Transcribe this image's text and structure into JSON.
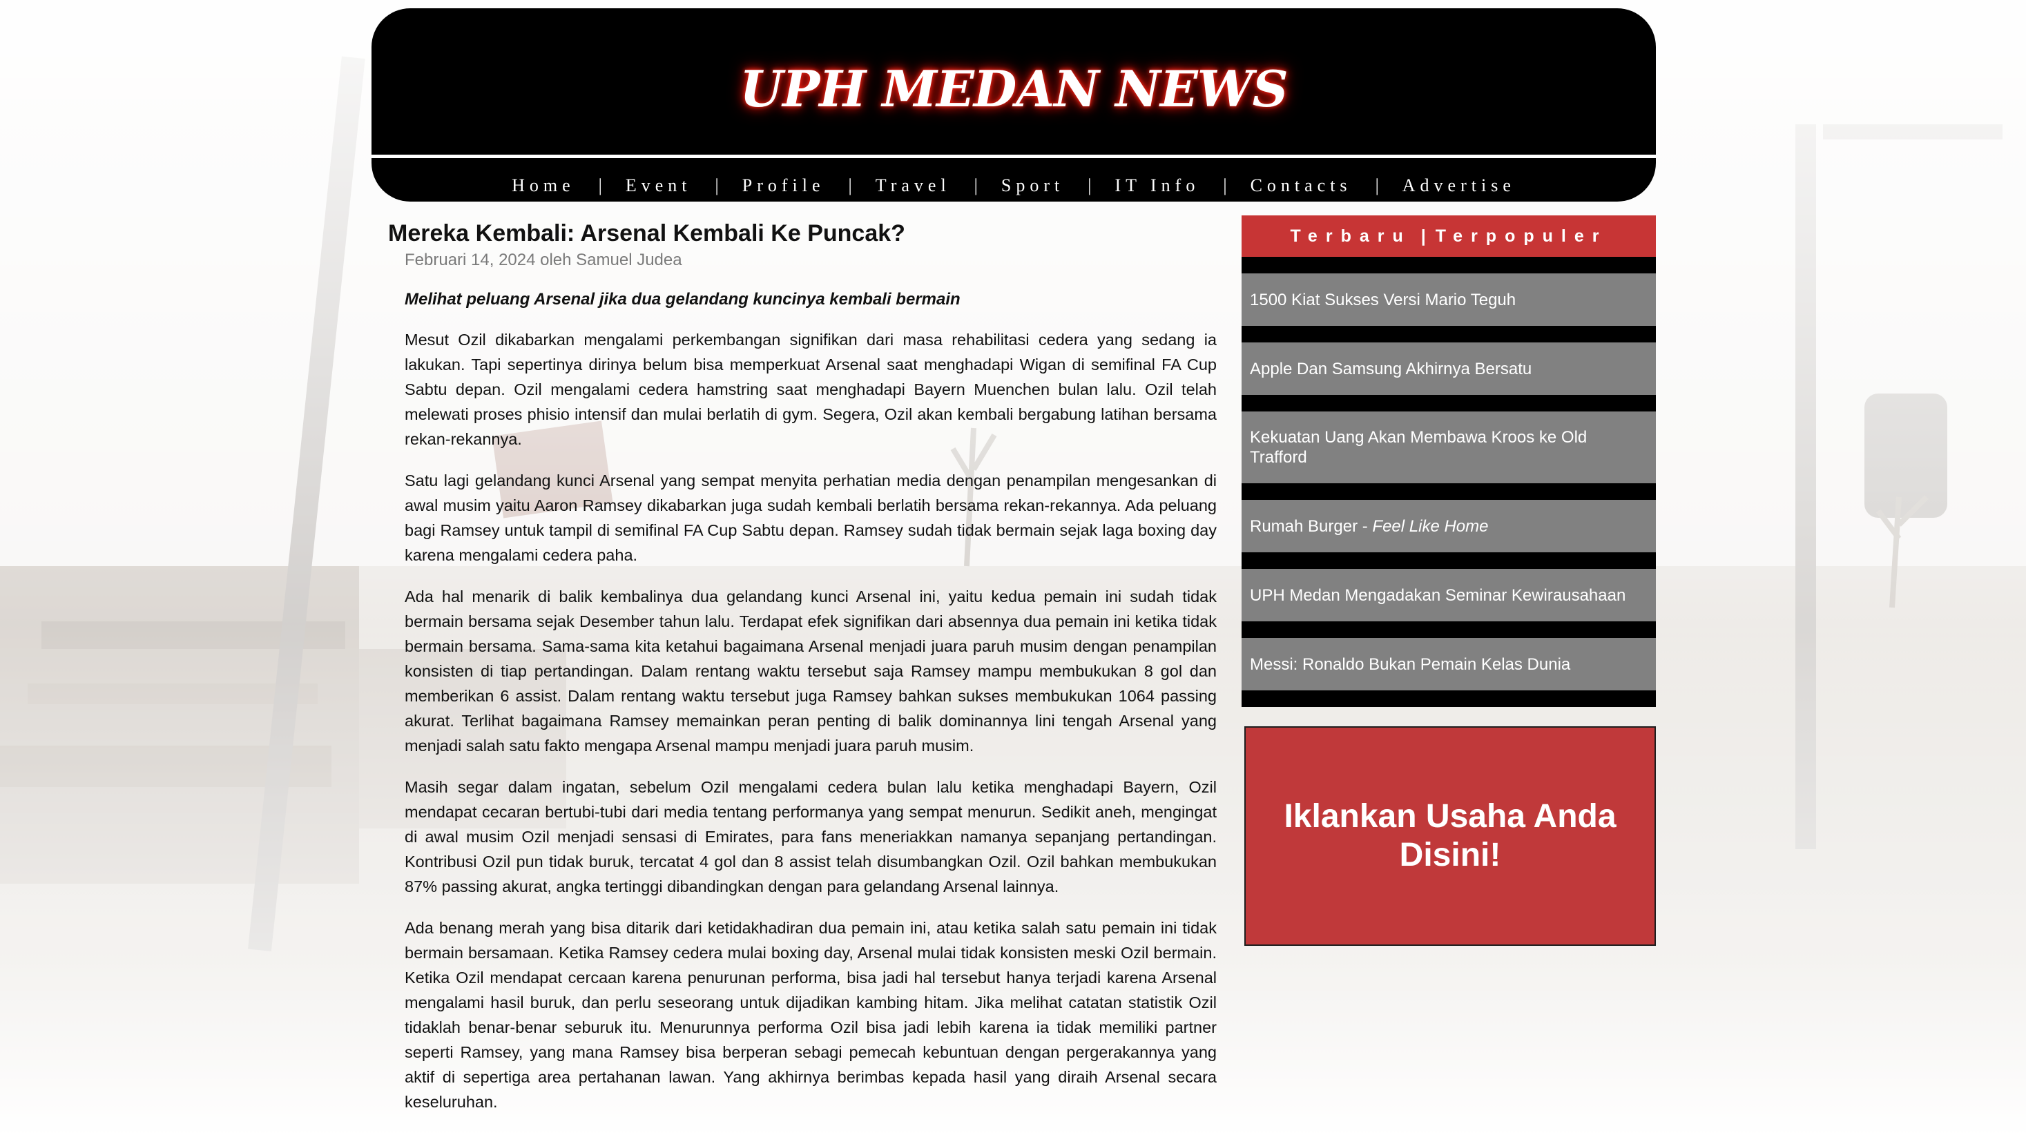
{
  "site": {
    "title": "UPH MEDAN NEWS"
  },
  "nav": {
    "items": [
      "Home",
      "Event",
      "Profile",
      "Travel",
      "Sport",
      "IT Info",
      "Contacts",
      "Advertise"
    ],
    "separator": "|"
  },
  "article": {
    "title": "Mereka Kembali: Arsenal Kembali Ke Puncak?",
    "meta": "Februari 14, 2024 oleh Samuel Judea",
    "lead": "Melihat peluang Arsenal jika dua gelandang kuncinya kembali bermain",
    "paragraphs": [
      "Mesut Ozil dikabarkan mengalami perkembangan signifikan dari masa rehabilitasi cedera yang sedang ia lakukan. Tapi sepertinya dirinya belum bisa memperkuat Arsenal saat menghadapi Wigan di semifinal FA Cup Sabtu depan. Ozil mengalami cedera hamstring saat menghadapi Bayern Muenchen bulan lalu. Ozil telah melewati proses phisio intensif dan mulai berlatih di gym. Segera, Ozil akan kembali bergabung latihan bersama rekan-rekannya.",
      "Satu lagi gelandang kunci Arsenal yang sempat menyita perhatian media dengan penampilan mengesankan di awal musim yaitu Aaron Ramsey dikabarkan juga sudah kembali berlatih bersama rekan-rekannya. Ada peluang bagi Ramsey untuk tampil di semifinal FA Cup Sabtu depan. Ramsey sudah tidak bermain sejak laga boxing day karena mengalami cedera paha.",
      "Ada hal menarik di balik kembalinya dua gelandang kunci Arsenal ini, yaitu kedua pemain ini sudah tidak bermain bersama sejak Desember tahun lalu. Terdapat efek signifikan dari absennya dua pemain ini ketika tidak bermain bersama. Sama-sama kita ketahui bagaimana Arsenal menjadi juara paruh musim dengan penampilan konsisten di tiap pertandingan. Dalam rentang waktu tersebut saja Ramsey mampu membukukan 8 gol dan memberikan 6 assist. Dalam rentang waktu tersebut juga Ramsey bahkan sukses membukukan 1064 passing akurat. Terlihat bagaimana Ramsey memainkan peran penting di balik dominannya lini tengah Arsenal yang menjadi salah satu fakto mengapa Arsenal mampu menjadi juara paruh musim.",
      "Masih segar dalam ingatan, sebelum Ozil mengalami cedera bulan lalu ketika menghadapi Bayern, Ozil mendapat cecaran bertubi-tubi dari media tentang performanya yang sempat menurun. Sedikit aneh, mengingat di awal musim Ozil menjadi sensasi di Emirates, para fans meneriakkan namanya sepanjang pertandingan. Kontribusi Ozil pun tidak buruk, tercatat 4 gol dan 8 assist telah disumbangkan Ozil. Ozil bahkan membukukan 87% passing akurat, angka tertinggi dibandingkan dengan para gelandang Arsenal lainnya.",
      "Ada benang merah yang bisa ditarik dari ketidakhadiran dua pemain ini, atau ketika salah satu pemain ini tidak bermain bersamaan. Ketika Ramsey cedera mulai boxing day, Arsenal mulai tidak konsisten meski Ozil bermain. Ketika Ozil mendapat cercaan karena penurunan performa, bisa jadi hal tersebut hanya terjadi karena Arsenal mengalami hasil buruk, dan perlu seseorang untuk dijadikan kambing hitam. Jika melihat catatan statistik Ozil tidaklah benar-benar seburuk itu. Menurunnya performa Ozil bisa jadi lebih karena ia tidak memiliki partner seperti Ramsey, yang mana Ramsey bisa berperan sebagi pemecah kebuntuan dengan pergerakannya yang aktif di sepertiga area pertahanan lawan. Yang akhirnya berimbas kepada hasil yang diraih Arsenal secara keseluruhan."
    ]
  },
  "sidebar": {
    "tabs": [
      "Terbaru",
      "Terpopuler"
    ],
    "tab_separator": "|",
    "news": [
      {
        "text": "1500 Kiat Sukses Versi Mario Teguh"
      },
      {
        "text": "Apple Dan Samsung Akhirnya Bersatu"
      },
      {
        "text": "Kekuatan Uang Akan Membawa Kroos ke Old Trafford"
      },
      {
        "text": "Rumah Burger - ",
        "italic": "Feel Like Home"
      },
      {
        "text": "UPH Medan Mengadakan Seminar Kewirausahaan"
      },
      {
        "text": "Messi: Ronaldo Bukan Pemain Kelas Dunia"
      }
    ],
    "ad_text": "Iklankan Usaha Anda Disini!"
  },
  "colors": {
    "header_bg": "#000000",
    "title_glow": "#e0190f",
    "tab_bg": "#c73535",
    "news_item_bg": "#818181",
    "ad_bg": "#c0393a"
  }
}
